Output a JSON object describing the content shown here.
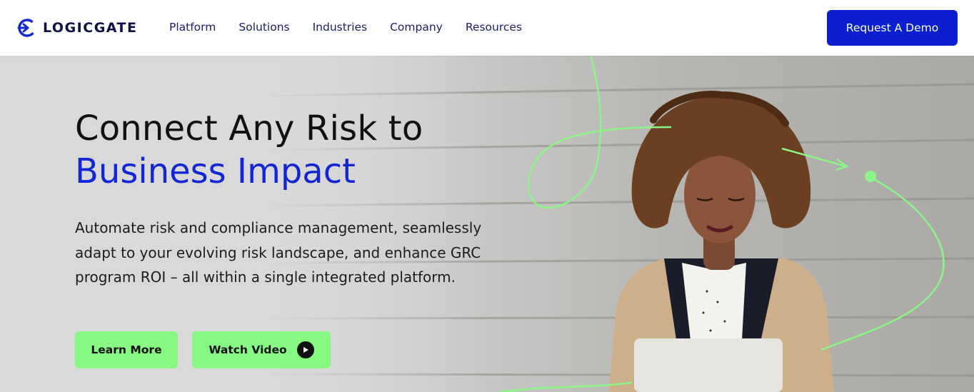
{
  "nav": {
    "logo_text": "LOGICGATE",
    "menu": [
      "Platform",
      "Solutions",
      "Industries",
      "Company",
      "Resources"
    ],
    "cta_label": "Request A Demo"
  },
  "hero": {
    "headline_line1": "Connect Any Risk to",
    "headline_line2": "Business Impact",
    "description": "Automate risk and compliance management, seamlessly adapt to your evolving risk landscape, and enhance GRC program ROI – all within a single integrated platform.",
    "learn_more_label": "Learn More",
    "watch_video_label": "Watch Video"
  },
  "colors": {
    "brand_blue": "#0b1fd1",
    "headline_blue": "#1326d6",
    "accent_green": "#87f983",
    "nav_text": "#1a1e6b"
  },
  "icons": [
    "logicgate-logo-icon",
    "play-icon"
  ]
}
